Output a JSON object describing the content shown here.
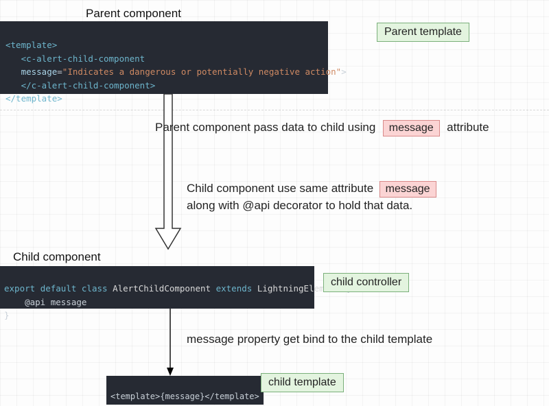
{
  "titles": {
    "parent": "Parent component",
    "child": "Child component"
  },
  "badges": {
    "parent_template": "Parent template",
    "child_controller": "child controller",
    "child_template": "child template",
    "message1": "message",
    "message2": "message"
  },
  "annotations": {
    "a1_pre": "Parent component pass data to child using",
    "a1_post": "attribute",
    "a2_line1_pre": "Child component use same attribute",
    "a2_line2": "along with @api decorator to hold that data.",
    "a3": "message property get bind to the child template"
  },
  "code": {
    "parent": {
      "open_template": "<template>",
      "child_open": "<c-alert-child-component",
      "attr_name": "message",
      "attr_value": "\"Indicates a dangerous or potentially negative action\"",
      "child_close": "</c-alert-child-component>",
      "close_template": "</template>"
    },
    "controller": {
      "kw_export": "export",
      "kw_default": "default",
      "kw_class": "class",
      "class_name": "AlertChildComponent",
      "kw_extends": "extends",
      "base_class": "LightningElement",
      "brace_open": "{",
      "api_line": "    @api message",
      "brace_close": "}"
    },
    "child_template": {
      "inline": "<template>{message}</template>"
    }
  }
}
